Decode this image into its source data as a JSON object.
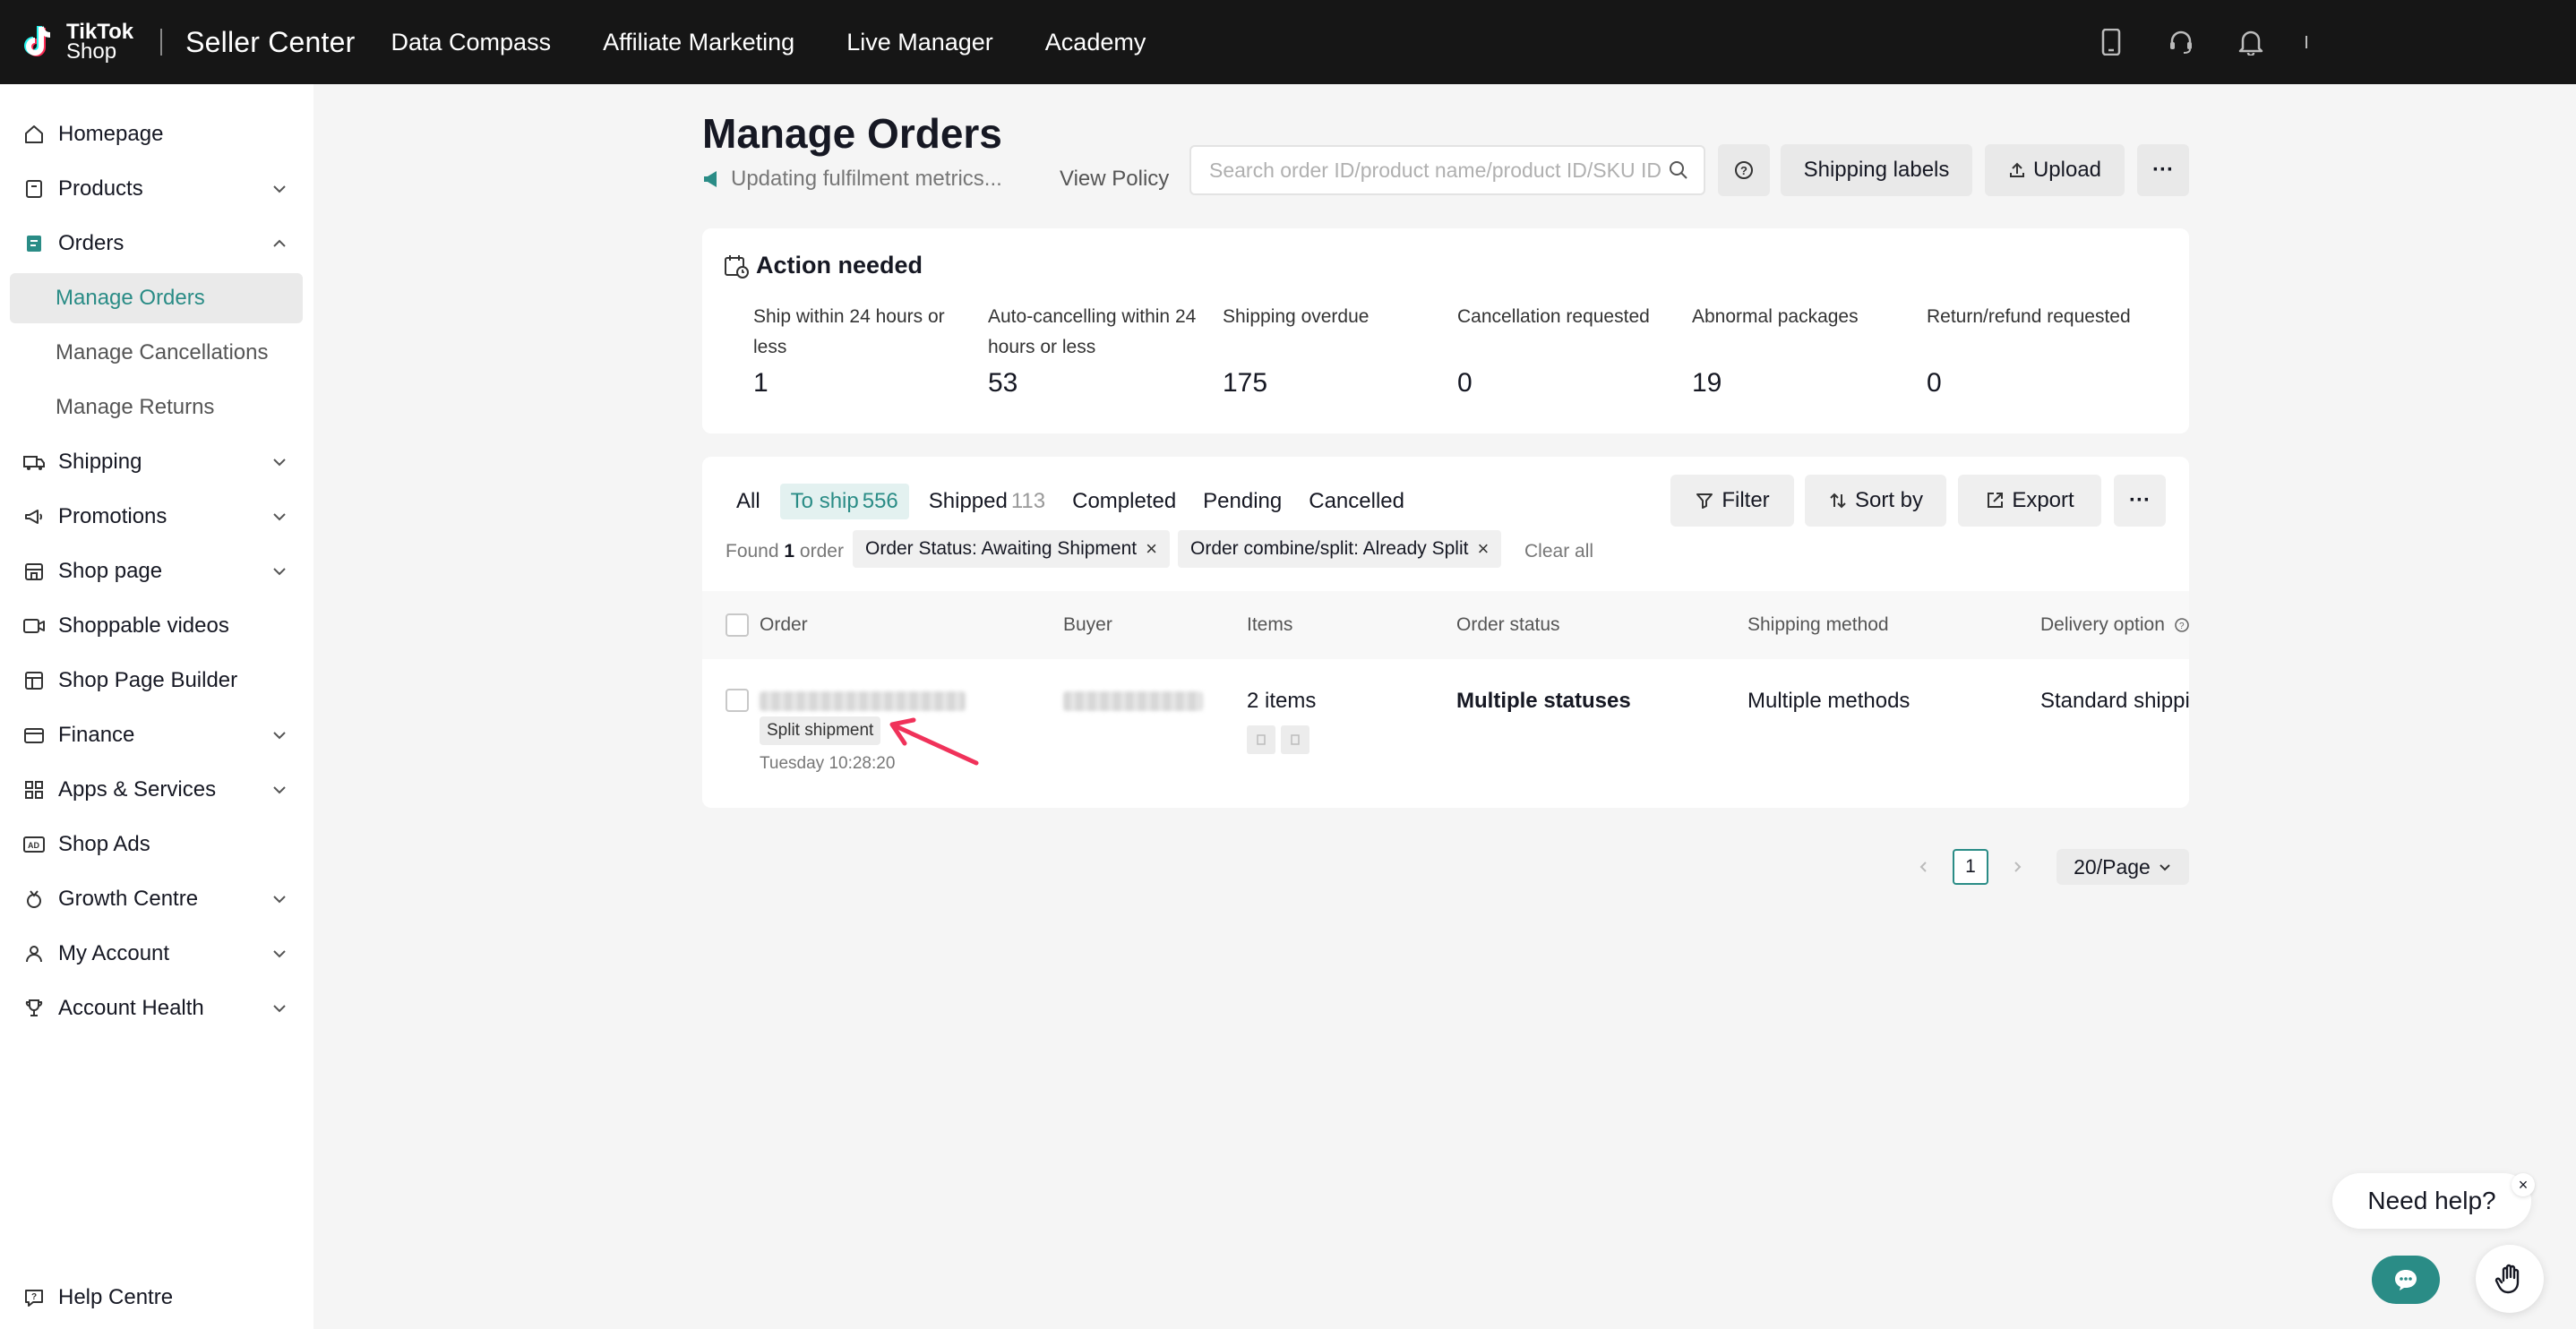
{
  "header": {
    "brand_line1": "TikTok",
    "brand_line2": "Shop",
    "title": "Seller Center",
    "nav": [
      "Data Compass",
      "Affiliate Marketing",
      "Live Manager",
      "Academy"
    ]
  },
  "sidebar": {
    "items": [
      {
        "label": "Homepage",
        "icon": "home-icon"
      },
      {
        "label": "Products",
        "icon": "box-icon"
      },
      {
        "label": "Orders",
        "icon": "orders-icon"
      },
      {
        "label": "Manage Orders"
      },
      {
        "label": "Manage Cancellations"
      },
      {
        "label": "Manage Returns"
      },
      {
        "label": "Shipping",
        "icon": "truck-icon"
      },
      {
        "label": "Promotions",
        "icon": "megaphone-icon"
      },
      {
        "label": "Shop page",
        "icon": "store-icon"
      },
      {
        "label": "Shoppable videos",
        "icon": "video-icon"
      },
      {
        "label": "Shop Page Builder",
        "icon": "builder-icon"
      },
      {
        "label": "Finance",
        "icon": "wallet-icon"
      },
      {
        "label": "Apps & Services",
        "icon": "apps-icon"
      },
      {
        "label": "Shop Ads",
        "icon": "ads-icon"
      },
      {
        "label": "Growth Centre",
        "icon": "medal-icon"
      },
      {
        "label": "My Account",
        "icon": "user-icon"
      },
      {
        "label": "Account Health",
        "icon": "trophy-icon"
      }
    ],
    "help": "Help Centre"
  },
  "main": {
    "title": "Manage Orders",
    "notice": "Updating fulfilment metrics...",
    "view_policy": "View Policy",
    "search_placeholder": "Search order ID/product name/product ID/SKU ID",
    "shipping_labels": "Shipping labels",
    "upload": "Upload",
    "more": "···"
  },
  "action_needed": {
    "title": "Action needed",
    "metrics": [
      {
        "label": "Ship within 24 hours or less",
        "value": "1"
      },
      {
        "label": "Auto-cancelling within 24 hours or less",
        "value": "53"
      },
      {
        "label": "Shipping overdue",
        "value": "175"
      },
      {
        "label": "Cancellation requested",
        "value": "0"
      },
      {
        "label": "Abnormal packages",
        "value": "19"
      },
      {
        "label": "Return/refund requested",
        "value": "0"
      }
    ]
  },
  "orders": {
    "tabs": [
      {
        "label": "All",
        "count": ""
      },
      {
        "label": "To ship",
        "count": "556"
      },
      {
        "label": "Shipped",
        "count": "113"
      },
      {
        "label": "Completed",
        "count": ""
      },
      {
        "label": "Pending",
        "count": ""
      },
      {
        "label": "Cancelled",
        "count": ""
      }
    ],
    "filter": "Filter",
    "sort_by": "Sort by",
    "export": "Export",
    "found_prefix": "Found",
    "found_count": "1",
    "found_suffix": "order",
    "chips": [
      "Order Status:  Awaiting Shipment",
      "Order combine/split:  Already Split"
    ],
    "clear_all": "Clear all",
    "columns": [
      "Order",
      "Buyer",
      "Items",
      "Order status",
      "Shipping method",
      "Delivery option"
    ],
    "row": {
      "split_tag": "Split shipment",
      "date": "Tuesday 10:28:20",
      "items": "2 items",
      "status": "Multiple statuses",
      "shipping": "Multiple methods",
      "delivery": "Standard shipping"
    }
  },
  "pagination": {
    "page": "1",
    "per_page": "20/Page"
  },
  "help_widget": {
    "label": "Need help?",
    "close": "×"
  },
  "colors": {
    "accent": "#2a8c86",
    "annotation_arrow": "#f0325a",
    "topbar": "#161616"
  }
}
